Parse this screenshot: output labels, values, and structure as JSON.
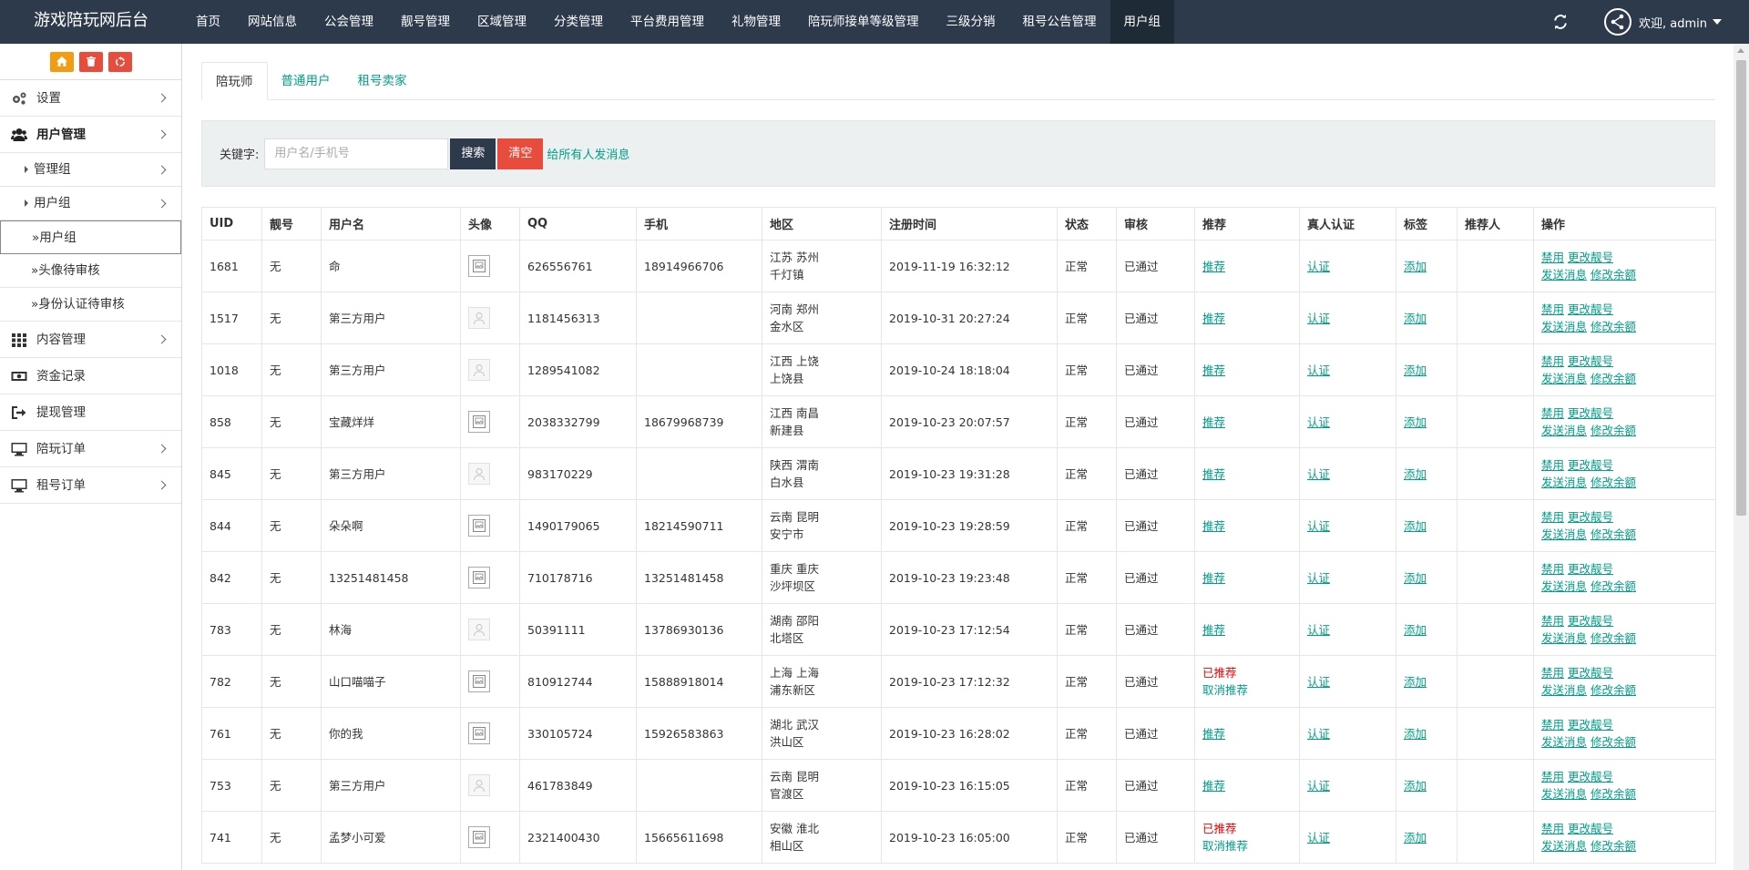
{
  "header": {
    "brand": "游戏陪玩网后台",
    "nav": [
      "首页",
      "网站信息",
      "公会管理",
      "靓号管理",
      "区域管理",
      "分类管理",
      "平台费用管理",
      "礼物管理",
      "陪玩师接单等级管理",
      "三级分销",
      "租号公告管理",
      "用户组"
    ],
    "active_nav": "用户组",
    "welcome": "欢迎, admin"
  },
  "sidebar": {
    "items": [
      {
        "label": "设置"
      },
      {
        "label": "用户管理"
      },
      {
        "label": "管理组"
      },
      {
        "label": "用户组"
      },
      {
        "label": "»用户组"
      },
      {
        "label": "»头像待审核"
      },
      {
        "label": "»身份认证待审核"
      },
      {
        "label": "内容管理"
      },
      {
        "label": "资金记录"
      },
      {
        "label": "提现管理"
      },
      {
        "label": "陪玩订单"
      },
      {
        "label": "租号订单"
      }
    ]
  },
  "tabs": [
    "陪玩师",
    "普通用户",
    "租号卖家"
  ],
  "search": {
    "label": "关键字:",
    "placeholder": "用户名/手机号",
    "search_btn": "搜索",
    "clear_btn": "清空",
    "broadcast_link": "给所有人发消息"
  },
  "table": {
    "columns": [
      "UID",
      "靓号",
      "用户名",
      "头像",
      "QQ",
      "手机",
      "地区",
      "注册时间",
      "状态",
      "审核",
      "推荐",
      "真人认证",
      "标签",
      "推荐人",
      "操作"
    ],
    "actions": {
      "ban": "禁用",
      "change_number": "更改靓号",
      "send_msg": "发送消息",
      "edit_balance": "修改余额"
    },
    "recommend_link": "推荐",
    "recommended_label": "已推荐",
    "cancel_recommend": "取消推荐",
    "certify_link": "认证",
    "tag_link": "添加",
    "rows": [
      {
        "uid": "1681",
        "number": "无",
        "name": "命",
        "avatar": "image",
        "qq": "626556761",
        "phone": "18914966706",
        "region1": "江苏 苏州",
        "region2": "千灯镇",
        "time": "2019-11-19 16:32:12",
        "status": "正常",
        "audit": "已通过",
        "recommended": false
      },
      {
        "uid": "1517",
        "number": "无",
        "name": "第三方用户",
        "avatar": "default",
        "qq": "1181456313",
        "phone": "",
        "region1": "河南 郑州",
        "region2": "金水区",
        "time": "2019-10-31 20:27:24",
        "status": "正常",
        "audit": "已通过",
        "recommended": false
      },
      {
        "uid": "1018",
        "number": "无",
        "name": "第三方用户",
        "avatar": "default",
        "qq": "1289541082",
        "phone": "",
        "region1": "江西 上饶",
        "region2": "上饶县",
        "time": "2019-10-24 18:18:04",
        "status": "正常",
        "audit": "已通过",
        "recommended": false
      },
      {
        "uid": "858",
        "number": "无",
        "name": "宝藏烊烊",
        "avatar": "image",
        "qq": "2038332799",
        "phone": "18679968739",
        "region1": "江西 南昌",
        "region2": "新建县",
        "time": "2019-10-23 20:07:57",
        "status": "正常",
        "audit": "已通过",
        "recommended": false
      },
      {
        "uid": "845",
        "number": "无",
        "name": "第三方用户",
        "avatar": "default",
        "qq": "983170229",
        "phone": "",
        "region1": "陕西 渭南",
        "region2": "白水县",
        "time": "2019-10-23 19:31:28",
        "status": "正常",
        "audit": "已通过",
        "recommended": false
      },
      {
        "uid": "844",
        "number": "无",
        "name": "朵朵啊",
        "avatar": "image",
        "qq": "1490179065",
        "phone": "18214590711",
        "region1": "云南 昆明",
        "region2": "安宁市",
        "time": "2019-10-23 19:28:59",
        "status": "正常",
        "audit": "已通过",
        "recommended": false
      },
      {
        "uid": "842",
        "number": "无",
        "name": "13251481458",
        "avatar": "image",
        "qq": "710178716",
        "phone": "13251481458",
        "region1": "重庆 重庆",
        "region2": "沙坪坝区",
        "time": "2019-10-23 19:23:48",
        "status": "正常",
        "audit": "已通过",
        "recommended": false
      },
      {
        "uid": "783",
        "number": "无",
        "name": "林海",
        "avatar": "default",
        "qq": "50391111",
        "phone": "13786930136",
        "region1": "湖南 邵阳",
        "region2": "北塔区",
        "time": "2019-10-23 17:12:54",
        "status": "正常",
        "audit": "已通过",
        "recommended": false
      },
      {
        "uid": "782",
        "number": "无",
        "name": "山口喵喵子",
        "avatar": "image",
        "qq": "810912744",
        "phone": "15888918014",
        "region1": "上海 上海",
        "region2": "浦东新区",
        "time": "2019-10-23 17:12:32",
        "status": "正常",
        "audit": "已通过",
        "recommended": true
      },
      {
        "uid": "761",
        "number": "无",
        "name": "你的我",
        "avatar": "image",
        "qq": "330105724",
        "phone": "15926583863",
        "region1": "湖北 武汉",
        "region2": "洪山区",
        "time": "2019-10-23 16:28:02",
        "status": "正常",
        "audit": "已通过",
        "recommended": false
      },
      {
        "uid": "753",
        "number": "无",
        "name": "第三方用户",
        "avatar": "default",
        "qq": "461783849",
        "phone": "",
        "region1": "云南 昆明",
        "region2": "官渡区",
        "time": "2019-10-23 16:15:05",
        "status": "正常",
        "audit": "已通过",
        "recommended": false
      },
      {
        "uid": "741",
        "number": "无",
        "name": "孟梦小可爱",
        "avatar": "image",
        "qq": "2321400430",
        "phone": "15665611698",
        "region1": "安徽 淮北",
        "region2": "相山区",
        "time": "2019-10-23 16:05:00",
        "status": "正常",
        "audit": "已通过",
        "recommended": true
      }
    ]
  },
  "colors": {
    "topbar": "#2d3a4b",
    "accent": "#009e88",
    "danger": "#e74c3c",
    "warning": "#f39c12"
  }
}
